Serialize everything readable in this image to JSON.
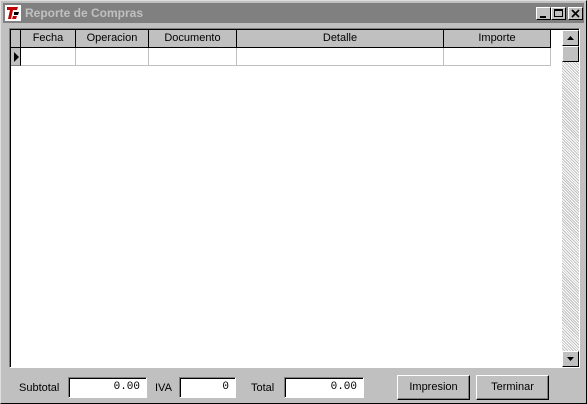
{
  "window": {
    "title": "Reporte de Compras",
    "icon": "app-logo-icon",
    "controls": [
      "minimize-icon",
      "maximize-icon",
      "close-icon"
    ]
  },
  "grid": {
    "columns": [
      "Fecha",
      "Operacion",
      "Documento",
      "Detalle",
      "Importe"
    ],
    "rows": [
      {
        "fecha": "",
        "operacion": "",
        "documento": "",
        "detalle": "",
        "importe": ""
      }
    ],
    "current_row_indicator": "row-pointer-icon"
  },
  "footer": {
    "subtotal_label": "Subtotal",
    "subtotal_value": "0.00",
    "iva_label": "IVA",
    "iva_value": "0",
    "total_label": "Total",
    "total_value": "0.00",
    "print_button": "Impresion",
    "close_button": "Terminar"
  }
}
